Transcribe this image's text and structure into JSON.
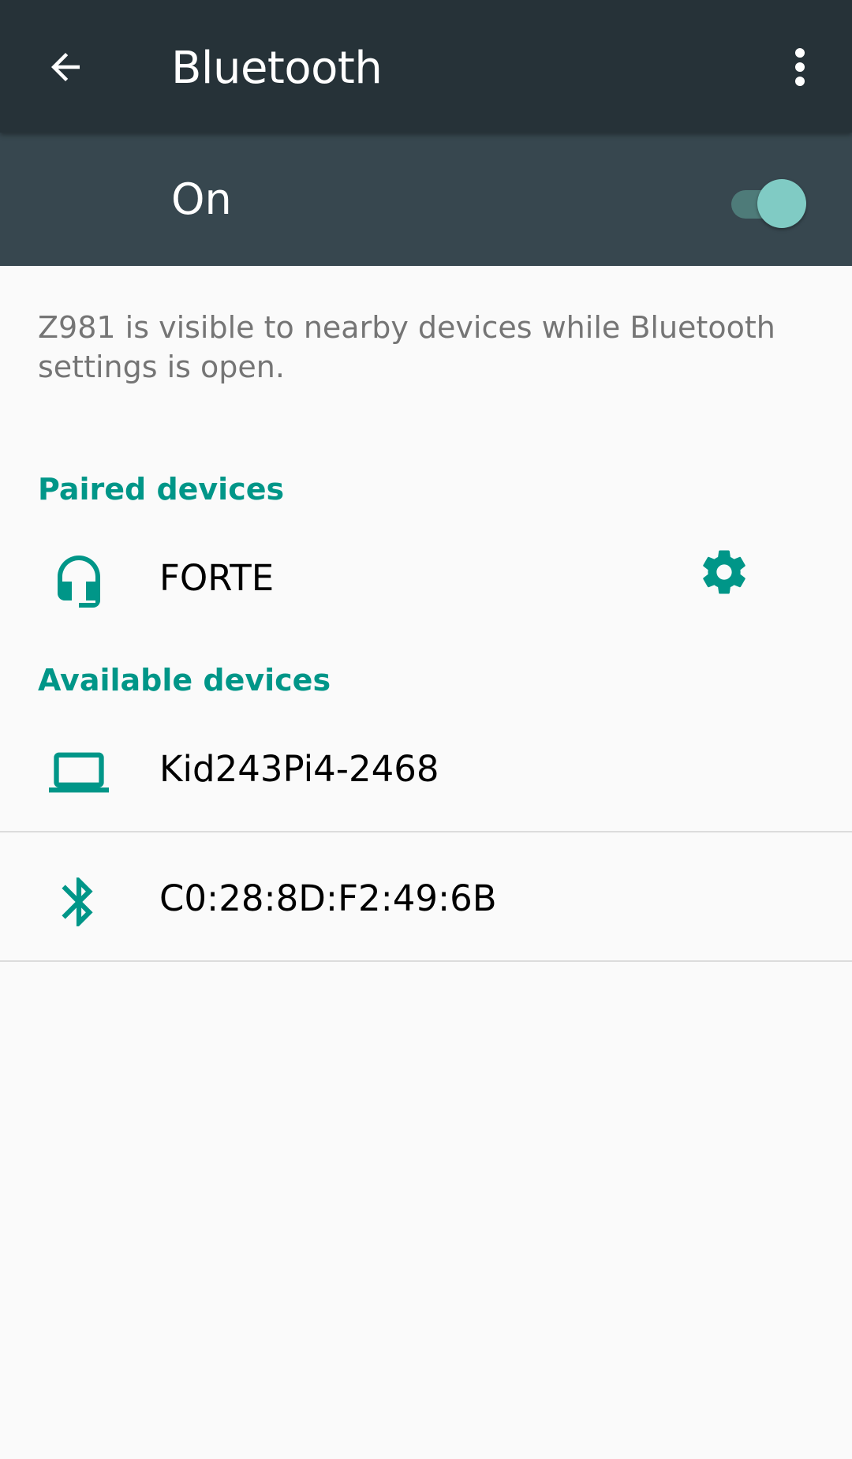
{
  "app_bar": {
    "title": "Bluetooth",
    "back_icon": "arrow-left-icon",
    "menu_icon": "more-vert-icon",
    "background": "#263238"
  },
  "master_switch": {
    "label": "On",
    "state": "on",
    "background": "#37474f",
    "thumb_color": "#80cbc4"
  },
  "visibility_message": "Z981 is visible to nearby devices while Bluetooth settings is open.",
  "paired": {
    "header": "Paired devices",
    "devices": [
      {
        "name": "FORTE",
        "icon": "headset-icon",
        "settings_icon": "gear-icon"
      }
    ]
  },
  "available": {
    "header": "Available devices",
    "devices": [
      {
        "name": "Kid243Pi4-2468",
        "icon": "laptop-icon"
      },
      {
        "name": "C0:28:8D:F2:49:6B",
        "icon": "bluetooth-icon"
      }
    ]
  },
  "colors": {
    "accent": "#009688"
  }
}
